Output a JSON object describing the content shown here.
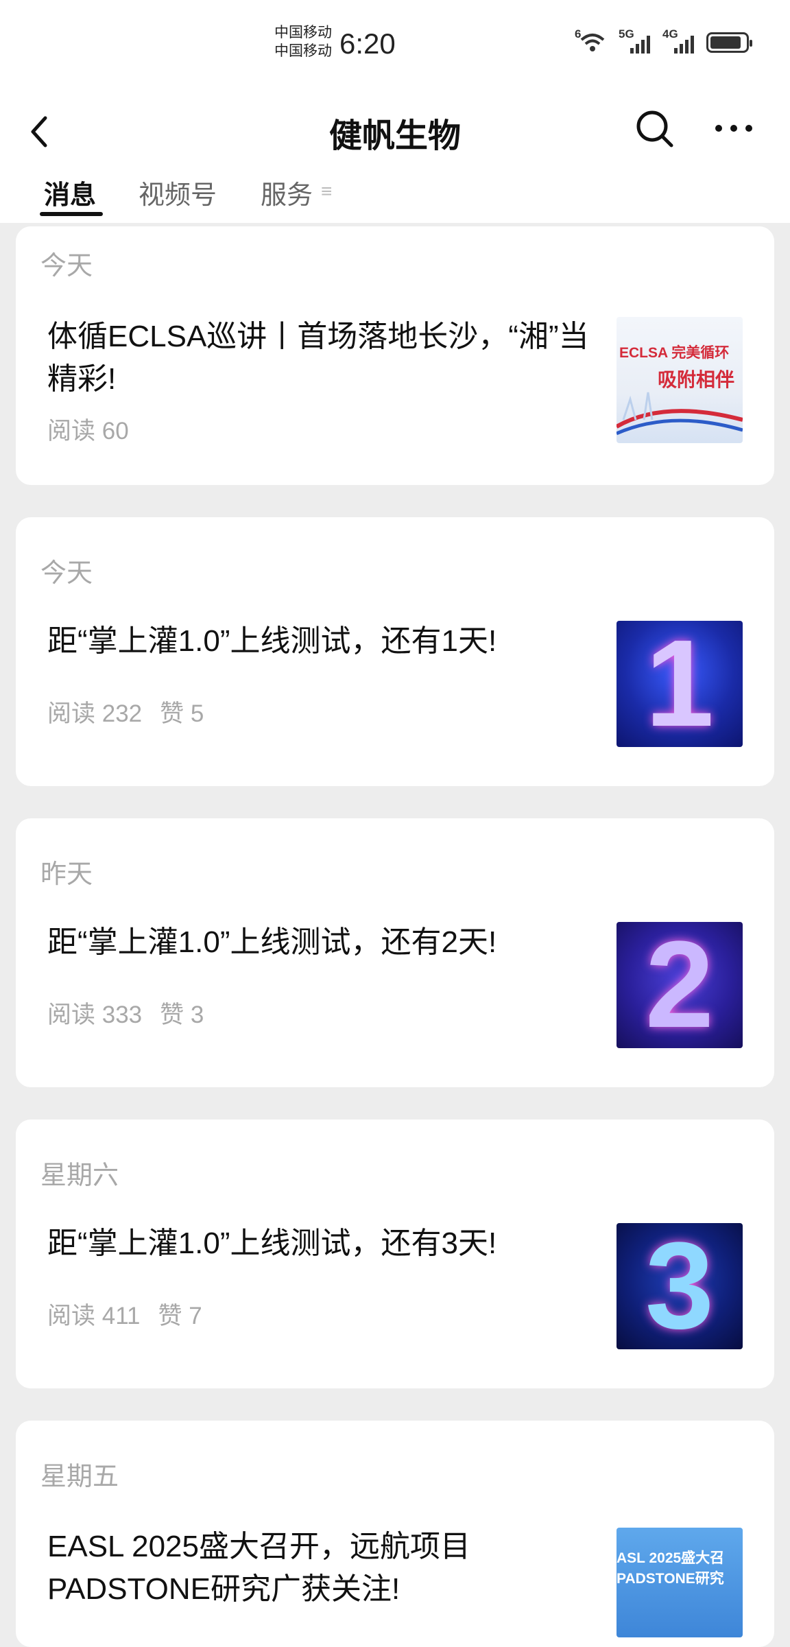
{
  "status_bar": {
    "carrier_1": "中国移动",
    "carrier_2": "中国移动",
    "time": "6:20",
    "wifi_label": "6",
    "signal_1_label": "5G",
    "signal_2_label": "4G"
  },
  "header": {
    "title": "健帆生物",
    "back_icon": "chevron-left-icon",
    "search_icon": "search-icon",
    "more_icon": "more-horizontal-icon"
  },
  "tabs": [
    {
      "label": "消息",
      "active": true
    },
    {
      "label": "视频号",
      "active": false
    },
    {
      "label": "服务",
      "active": false
    }
  ],
  "articles": [
    {
      "day": "今天",
      "title": "体循ECLSA巡讲丨首场落地长沙，“湘”当精彩!",
      "reads": "阅读 60",
      "likes": "",
      "thumb_lines": [
        "ECLSA 完美循环",
        "吸附相伴"
      ]
    },
    {
      "day": "今天",
      "title": "距“掌上灌1.0”上线测试，还有1天!",
      "reads": "阅读 232",
      "likes": "赞 5",
      "thumb_numeral": "1"
    },
    {
      "day": "昨天",
      "title": "距“掌上灌1.0”上线测试，还有2天!",
      "reads": "阅读 333",
      "likes": "赞 3",
      "thumb_numeral": "2"
    },
    {
      "day": "星期六",
      "title": "距“掌上灌1.0”上线测试，还有3天!",
      "reads": "阅读 411",
      "likes": "赞 7",
      "thumb_numeral": "3"
    },
    {
      "day": "星期五",
      "title": "EASL 2025盛大召开，远航项目PADSTONE研究广获关注!",
      "reads": "",
      "likes": "",
      "thumb_lines": [
        "ASL 2025盛大召",
        "PADSTONE研究"
      ]
    }
  ],
  "colors": {
    "background": "#ededed",
    "card": "#ffffff",
    "muted_text": "#a8a8a8",
    "primary_text": "#111111"
  }
}
